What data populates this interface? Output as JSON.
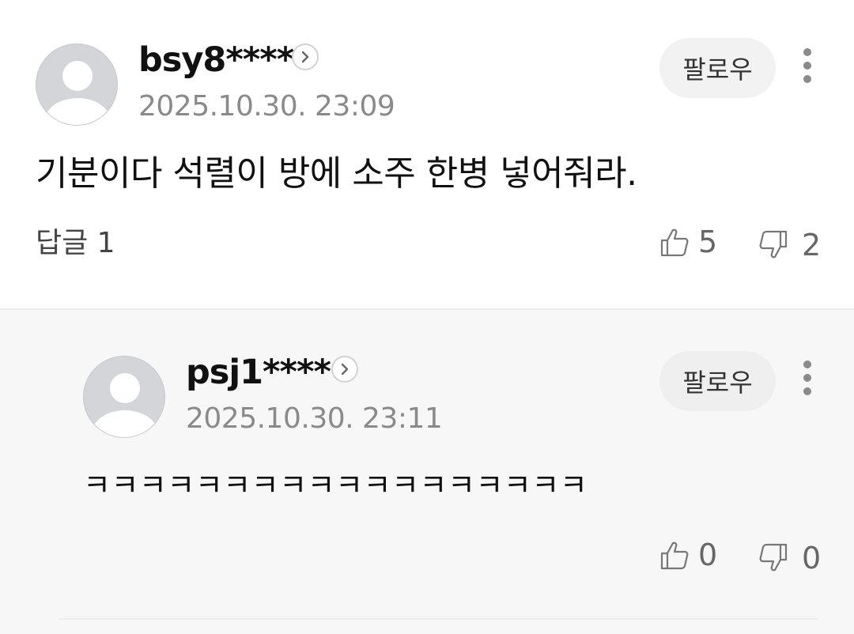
{
  "comment": {
    "username": "bsy8****",
    "date": "2025.10.30. 23:09",
    "text": "기분이다 석렬이 방에 소주 한병 넣어줘라.",
    "follow_label": "팔로우",
    "replies_label": "답글 1",
    "likes": "5",
    "dislikes": "2"
  },
  "reply": {
    "username": "psj1****",
    "date": "2025.10.30. 23:11",
    "text": "ㅋㅋㅋㅋㅋㅋㅋㅋㅋㅋㅋㅋㅋㅋㅋㅋㅋㅋ",
    "follow_label": "팔로우",
    "likes": "0",
    "dislikes": "0"
  },
  "icons": [
    "avatar-icon",
    "chevron-right-icon",
    "more-vertical-icon",
    "thumbs-up-icon",
    "thumbs-down-icon"
  ],
  "colors": {
    "reply_background": "#f7f7f8",
    "follow_button": "#f2f2f2",
    "meta_text": "#8a8a8a"
  }
}
